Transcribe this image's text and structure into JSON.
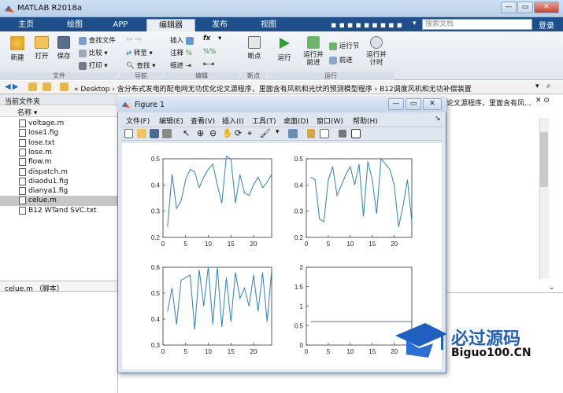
{
  "window": {
    "title": "MATLAB R2018a"
  },
  "tabs": [
    {
      "label": "主页"
    },
    {
      "label": "绘图"
    },
    {
      "label": "APP"
    },
    {
      "label": "编辑器",
      "active": true
    },
    {
      "label": "发布"
    },
    {
      "label": "视图"
    }
  ],
  "search": {
    "placeholder": "搜索文档"
  },
  "login": "登录",
  "ribbon": {
    "file_group": {
      "label": "文件",
      "new": "新建",
      "open": "打开",
      "save": "保存",
      "find_files": "查找文件",
      "compare": "比较",
      "print": "打印"
    },
    "nav_group": {
      "label": "导航",
      "goto": "转至",
      "find": "查找"
    },
    "edit_group": {
      "label": "编辑",
      "insert": "插入",
      "comment": "注释",
      "indent": "缩进",
      "fx": "fx"
    },
    "bp_group": {
      "label": "断点",
      "breakpoints": "断点"
    },
    "run_group": {
      "label": "运行",
      "run": "运行",
      "run_advance": "运行并\n前进",
      "run_section": "运行节",
      "advance": "前进",
      "run_time": "运行并\n计时"
    }
  },
  "address": {
    "path": "« Desktop › 含分布式发电的配电网无功优化论文源程序，里面含有风机和光伏的预测模型程序 › B12调度风机和无功补偿装置"
  },
  "current_folder": {
    "title": "当前文件夹",
    "col_name": "名称 ▾",
    "files": [
      {
        "name": "voltage.m"
      },
      {
        "name": "lose1.fig"
      },
      {
        "name": "lose.txt"
      },
      {
        "name": "lose.m"
      },
      {
        "name": "flow.m"
      },
      {
        "name": "dispatch.m"
      },
      {
        "name": "diaodu1.fig"
      },
      {
        "name": "dianya1.fig"
      },
      {
        "name": "celue.m",
        "selected": true
      },
      {
        "name": "B12 WTand SVC.txt"
      }
    ],
    "status": "celue.m （脚本）"
  },
  "right_text": "论文源程序，里面含有风...",
  "figure": {
    "title": "Figure 1",
    "menu": [
      "文件(F)",
      "编辑(E)",
      "查看(V)",
      "插入(I)",
      "工具(T)",
      "桌面(D)",
      "窗口(W)",
      "帮助(H)"
    ]
  },
  "chart_data": [
    {
      "type": "line",
      "x": [
        1,
        2,
        3,
        4,
        5,
        6,
        7,
        8,
        9,
        10,
        11,
        12,
        13,
        14,
        15,
        16,
        17,
        18,
        19,
        20,
        21,
        22,
        23,
        24
      ],
      "values": [
        0.24,
        0.44,
        0.31,
        0.34,
        0.42,
        0.46,
        0.45,
        0.39,
        0.43,
        0.46,
        0.48,
        0.4,
        0.33,
        0.51,
        0.5,
        0.33,
        0.44,
        0.37,
        0.36,
        0.4,
        0.43,
        0.39,
        0.41,
        0.44
      ],
      "xlim": [
        0,
        24
      ],
      "ylim": [
        0.2,
        0.5
      ],
      "xticks": [
        0,
        5,
        10,
        15,
        20
      ],
      "yticks": [
        0.2,
        0.3,
        0.4,
        0.5
      ]
    },
    {
      "type": "line",
      "x": [
        1,
        2,
        3,
        4,
        5,
        6,
        7,
        8,
        9,
        10,
        11,
        12,
        13,
        14,
        15,
        16,
        17,
        18,
        19,
        20,
        21,
        22,
        23,
        24
      ],
      "values": [
        0.43,
        0.42,
        0.27,
        0.26,
        0.42,
        0.47,
        0.36,
        0.4,
        0.44,
        0.47,
        0.4,
        0.48,
        0.28,
        0.49,
        0.42,
        0.29,
        0.5,
        0.48,
        0.46,
        0.4,
        0.24,
        0.32,
        0.42,
        0.26
      ],
      "xlim": [
        0,
        24
      ],
      "ylim": [
        0.2,
        0.5
      ],
      "xticks": [
        0,
        5,
        10,
        15,
        20
      ],
      "yticks": [
        0.2,
        0.3,
        0.4,
        0.5
      ]
    },
    {
      "type": "line",
      "x": [
        1,
        2,
        3,
        4,
        5,
        6,
        7,
        8,
        9,
        10,
        11,
        12,
        13,
        14,
        15,
        16,
        17,
        18,
        19,
        20,
        21,
        22,
        23,
        24
      ],
      "values": [
        0.43,
        0.52,
        0.38,
        0.55,
        0.56,
        0.57,
        0.36,
        0.59,
        0.45,
        0.6,
        0.38,
        0.6,
        0.37,
        0.56,
        0.39,
        0.58,
        0.48,
        0.52,
        0.45,
        0.57,
        0.43,
        0.58,
        0.39,
        0.59
      ],
      "xlim": [
        0,
        24
      ],
      "ylim": [
        0.3,
        0.6
      ],
      "xticks": [
        0,
        5,
        10,
        15,
        20
      ],
      "yticks": [
        0.3,
        0.4,
        0.5,
        0.6
      ]
    },
    {
      "type": "line",
      "x": [
        1,
        24
      ],
      "values": [
        0.6,
        0.6
      ],
      "xlim": [
        0,
        24
      ],
      "ylim": [
        0,
        2
      ],
      "xticks": [
        0,
        5,
        10,
        15,
        20
      ],
      "yticks": [
        0,
        0.5,
        1,
        1.5,
        2
      ]
    }
  ],
  "watermark": {
    "text": "必过源码",
    "sub": "Biguo100.CN"
  },
  "colors": {
    "line": "#2f7fc1",
    "tabbar": "#1f4f8a"
  }
}
